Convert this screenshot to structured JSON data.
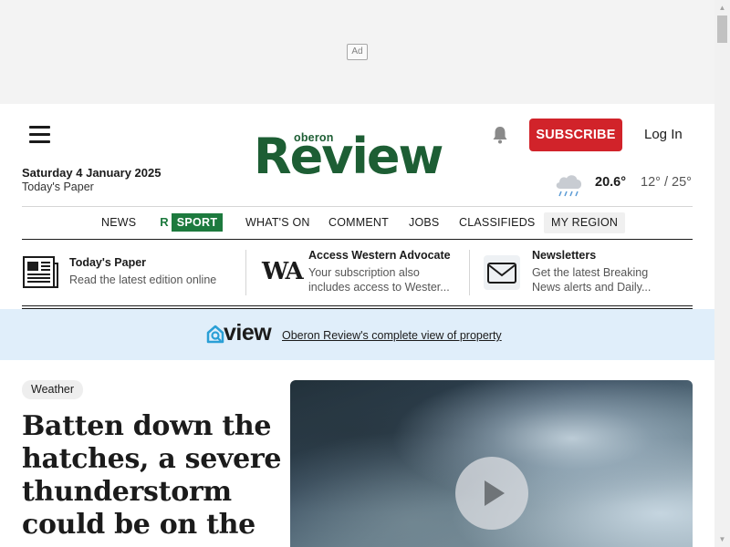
{
  "ad": {
    "label": "Ad"
  },
  "header": {
    "date": "Saturday 4 January 2025",
    "todays_paper": "Today's Paper",
    "logo": {
      "small": "oberon",
      "large": "Review"
    },
    "subscribe_label": "SUBSCRIBE",
    "login_label": "Log In",
    "weather": {
      "current": "20.6°",
      "range": "12° / 25°",
      "icon": "rain-cloud-icon"
    }
  },
  "nav": {
    "items": [
      {
        "label": "NEWS"
      },
      {
        "label": "SPORT",
        "badge": "R"
      },
      {
        "label": "WHAT'S ON"
      },
      {
        "label": "COMMENT"
      },
      {
        "label": "JOBS"
      },
      {
        "label": "CLASSIFIEDS"
      },
      {
        "label": "MY REGION"
      }
    ]
  },
  "promos": [
    {
      "icon": "newspaper-icon",
      "title": "Today's Paper",
      "sub": [
        "Read the latest edition online"
      ]
    },
    {
      "icon": "wa-logo",
      "logo_text": "WA",
      "title": "Access Western Advocate",
      "sub": [
        "Your subscription also",
        "includes access to Wester..."
      ]
    },
    {
      "icon": "envelope-icon",
      "title": "Newsletters",
      "sub": [
        "Get the latest Breaking",
        "News alerts and Daily..."
      ]
    }
  ],
  "view_banner": {
    "logo": "view",
    "link": "Oberon Review's complete view of property"
  },
  "article": {
    "tag": "Weather",
    "headline": "Batten down the hatches, a severe thunderstorm could be on the"
  },
  "colors": {
    "brand_green": "#1d5e34",
    "sport_green": "#1d7a3e",
    "subscribe_red": "#d1232a",
    "banner_blue": "#e0eefa"
  }
}
